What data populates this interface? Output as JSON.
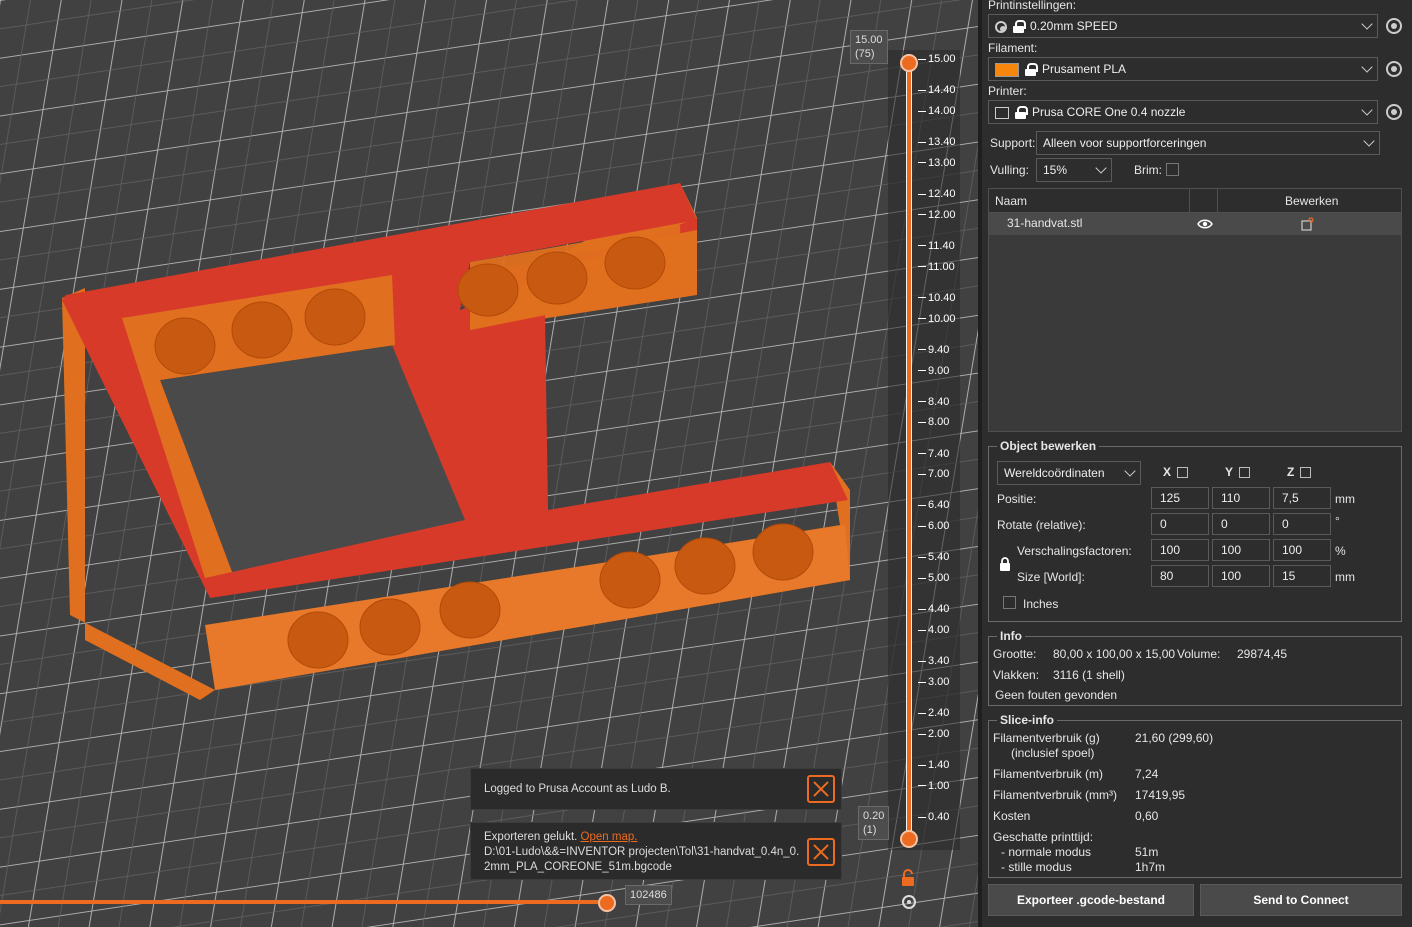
{
  "viewport": {
    "layer_top": {
      "height": "15.00",
      "layer": "(75)"
    },
    "layer_bottom": {
      "height": "0.20",
      "layer": "(1)"
    },
    "layer_ticks": [
      "15.00",
      "14.40",
      "14.00",
      "13.40",
      "13.00",
      "12.40",
      "12.00",
      "11.40",
      "11.00",
      "10.40",
      "10.00",
      "9.40",
      "9.00",
      "8.40",
      "8.00",
      "7.40",
      "7.00",
      "6.40",
      "6.00",
      "5.40",
      "5.00",
      "4.40",
      "4.00",
      "3.40",
      "3.00",
      "2.40",
      "2.00",
      "1.40",
      "1.00",
      "0.40"
    ],
    "move_counter": "102486",
    "notifications": [
      {
        "text": "Logged to Prusa Account as Ludo B."
      },
      {
        "text": "Exporteren gelukt.",
        "link": "Open map.",
        "path_line1": "D:\\01-Ludo\\&&=INVENTOR projecten\\Tol\\31-handvat_0.4n_0.",
        "path_line2": "2mm_PLA_COREONE_51m.bgcode"
      }
    ],
    "colors": {
      "model": "#ed6b21",
      "top": "#d83a2a",
      "bed": "#474747"
    }
  },
  "panel": {
    "print_settings": {
      "label": "Printinstellingen:",
      "value": "0.20mm SPEED"
    },
    "filament": {
      "label": "Filament:",
      "value": "Prusament PLA",
      "color": "#f7860c"
    },
    "printer": {
      "label": "Printer:",
      "value": "Prusa CORE One 0.4 nozzle"
    },
    "support": {
      "label": "Support:",
      "value": "Alleen voor supportforceringen"
    },
    "infill": {
      "label": "Vulling:",
      "value": "15%"
    },
    "brim": {
      "label": "Brim:"
    },
    "objects": {
      "col_name": "Naam",
      "col_edit": "Bewerken",
      "rows": [
        {
          "name": "31-handvat.stl"
        }
      ]
    },
    "object_edit": {
      "title": "Object bewerken",
      "coords": "Wereldcoördinaten",
      "axes": [
        "X",
        "Y",
        "Z"
      ],
      "position": {
        "label": "Positie:",
        "x": "125",
        "y": "110",
        "z": "7,5",
        "unit": "mm"
      },
      "rotation": {
        "label": "Rotate (relative):",
        "x": "0",
        "y": "0",
        "z": "0",
        "unit": "°"
      },
      "scale": {
        "label": "Verschalingsfactoren:",
        "x": "100",
        "y": "100",
        "z": "100",
        "unit": "%"
      },
      "size": {
        "label": "Size [World]:",
        "x": "80",
        "y": "100",
        "z": "15",
        "unit": "mm"
      },
      "inches": "Inches"
    },
    "info": {
      "title": "Info",
      "size_label": "Grootte:",
      "size_value": "80,00 x 100,00 x 15,00",
      "volume_label": "Volume:",
      "volume_value": "29874,45",
      "faces_label": "Vlakken:",
      "faces_value": "3116 (1 shell)",
      "errors": "Geen fouten gevonden"
    },
    "slice_info": {
      "title": "Slice-info",
      "fil_g_label": "Filamentverbruik (g)",
      "fil_g_sub": "(inclusief spoel)",
      "fil_g_value": "21,60 (299,60)",
      "fil_m_label": "Filamentverbruik (m)",
      "fil_m_value": "7,24",
      "fil_mm3_label": "Filamentverbruik (mm³)",
      "fil_mm3_value": "17419,95",
      "cost_label": "Kosten",
      "cost_value": "0,60",
      "time_label": "Geschatte printtijd:",
      "normal_label": "- normale modus",
      "normal_value": "51m",
      "silent_label": "- stille modus",
      "silent_value": "1h7m"
    },
    "buttons": {
      "export": "Exporteer .gcode-bestand",
      "connect": "Send to Connect"
    }
  }
}
